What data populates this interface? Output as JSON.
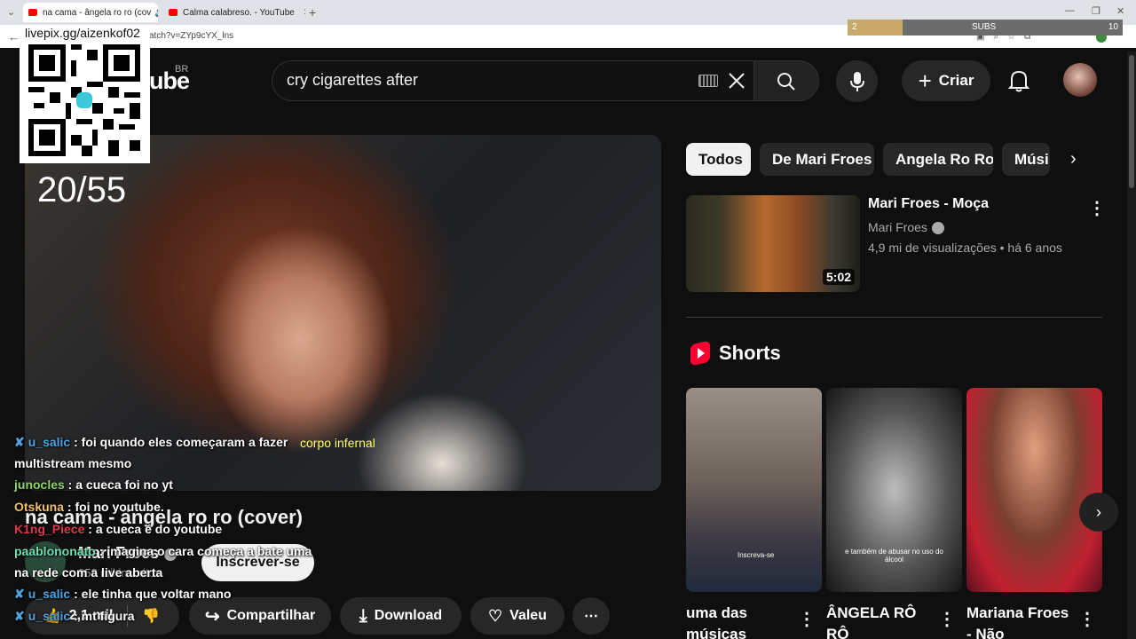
{
  "browser": {
    "tabs": [
      {
        "title": "na cama - ângela ro ro (cov",
        "active": true
      },
      {
        "title": "Calma calabreso. - YouTube",
        "active": false
      }
    ],
    "url_fragment": "atch?v=ZYp9cYX_lns",
    "new_tab_glyph": "+",
    "close_glyph": "✕"
  },
  "overlay": {
    "livepix": "livepix.gg/aizenkof02",
    "subs_label": "SUBS",
    "subs_current": "2",
    "subs_goal": "10",
    "subs_progress": 0.2,
    "counter": "20/55",
    "lyric": "corpo infernal"
  },
  "header": {
    "logo_text": "ube",
    "region": "BR",
    "search_value": "cry cigarettes after",
    "criar_label": "Criar"
  },
  "video": {
    "title": "na cama - ângela ro ro (cover)",
    "channel": "Mari Froes",
    "subscribers": "958 mil inscritos",
    "subscribe_label": "Inscrever-se",
    "actions": {
      "likes": "2,1 mil",
      "share": "Compartilhar",
      "download": "Download",
      "thanks": "Valeu"
    }
  },
  "chat": [
    {
      "user": "u_salic",
      "color": "#4fa3e0",
      "badge": true,
      "text": "foi quando eles começaram a fazer multistream mesmo",
      "wrap": true
    },
    {
      "user": "junocles",
      "color": "#8fd36b",
      "badge": false,
      "text": "a cueca foi no yt"
    },
    {
      "user": "Otskuna",
      "color": "#f0c070",
      "badge": false,
      "text": "foi no youtube."
    },
    {
      "user": "K1ng_Piece",
      "color": "#e0384d",
      "badge": false,
      "text": "a cueca é do youtube"
    },
    {
      "user": "paablononato",
      "color": "#6fe0b0",
      "badge": false,
      "text": "imagina o cara começa a bate uma na rede com a live aberta",
      "wrap": true
    },
    {
      "user": "u_salic",
      "color": "#4fa3e0",
      "badge": true,
      "text": "ele tinha que voltar mano"
    },
    {
      "user": "u_salic",
      "color": "#4fa3e0",
      "badge": true,
      "text": "mt figura"
    }
  ],
  "sidebar": {
    "chips": [
      "Todos",
      "De Mari Froes",
      "Angela Ro Ro",
      "Músi"
    ],
    "recommended": {
      "title": "Mari Froes - Moça",
      "channel": "Mari Froes",
      "meta": "4,9 mi de visualizações • há 6 anos",
      "duration": "5:02"
    },
    "shorts_heading": "Shorts",
    "shorts": [
      {
        "title": "uma das músicas",
        "caption": "Inscreva-se"
      },
      {
        "title": "ÂNGELA RÔ RÔ",
        "caption": "e também de abusar no uso do álcool"
      },
      {
        "title": "Mariana Froes - Não",
        "caption": ""
      }
    ]
  },
  "icons": {
    "search": "search-icon",
    "mic": "mic-icon",
    "bell": "bell-icon",
    "keyboard": "keyboard-icon",
    "clear": "close-icon"
  }
}
